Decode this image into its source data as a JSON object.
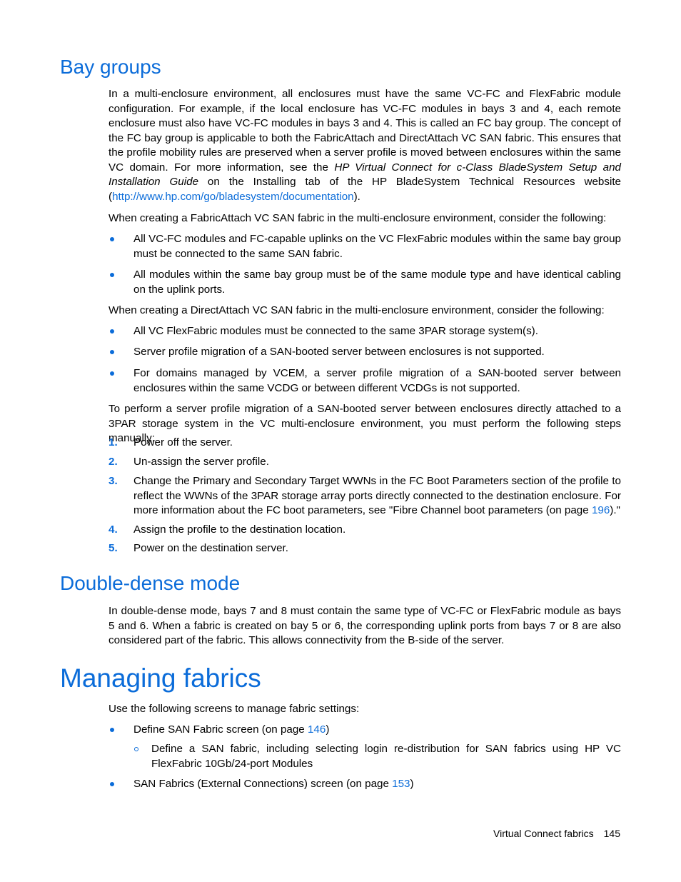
{
  "sections": {
    "bay_groups": {
      "title": "Bay groups",
      "p1_text": "In a multi-enclosure environment, all enclosures must have the same VC-FC and FlexFabric module configuration. For example, if the local enclosure has VC-FC modules in bays 3 and 4, each remote enclosure must also have VC-FC modules in bays 3 and 4. This is called an FC bay group. The concept of the FC bay group is applicable to both the FabricAttach and DirectAttach VC SAN fabric. This ensures that the profile mobility rules are preserved when a server profile is moved between enclosures within the same VC domain. For more information, see the ",
      "p1_italic": "HP Virtual Connect for c-Class BladeSystem Setup and Installation Guide",
      "p1_after_italic": " on the Installing tab of the HP BladeSystem Technical Resources website (",
      "p1_link": "http://www.hp.com/go/bladesystem/documentation",
      "p1_end": ").",
      "p2": "When creating a FabricAttach VC SAN fabric in the multi-enclosure environment, consider the following:",
      "fabricattach_bullets": [
        "All VC-FC modules and FC-capable uplinks on the VC FlexFabric modules within the same bay group must be connected to the same SAN fabric.",
        "All modules within the same bay group must be of the same module type and have identical cabling on the uplink ports."
      ],
      "p3": "When creating a DirectAttach VC SAN fabric in the multi-enclosure environment, consider the following:",
      "directattach_bullets": [
        "All VC FlexFabric modules must be connected to the same 3PAR storage system(s).",
        "Server profile migration of a SAN-booted server between enclosures is not supported.",
        "For domains managed by VCEM, a server profile migration of a SAN-booted server between enclosures within the same VCDG or between different VCDGs is not supported."
      ],
      "p4": "To perform a server profile migration of a SAN-booted server between enclosures directly attached to a 3PAR storage system in the VC multi-enclosure environment, you must perform the following steps manually:",
      "steps": [
        {
          "num": "1.",
          "text": "Power off the server."
        },
        {
          "num": "2.",
          "text": "Un-assign the server profile."
        },
        {
          "num": "3.",
          "text": "Change the Primary and Secondary Target WWNs in the FC Boot Parameters section of the profile to reflect the WWNs of the 3PAR storage array ports directly connected to the destination enclosure. For more information about the FC boot parameters, see \"Fibre Channel boot parameters (on page ",
          "link": "196",
          "end": ").\""
        },
        {
          "num": "4.",
          "text": "Assign the profile to the destination location."
        },
        {
          "num": "5.",
          "text": "Power on the destination server."
        }
      ]
    },
    "double_dense": {
      "title": "Double-dense mode",
      "p1": "In double-dense mode, bays 7 and 8 must contain the same type of VC-FC or FlexFabric module as bays 5 and 6. When a fabric is created on bay 5 or 6, the corresponding uplink ports from bays 7 or 8 are also considered part of the fabric. This allows connectivity from the B-side of the server."
    },
    "managing_fabrics": {
      "title": "Managing fabrics",
      "p1": "Use the following screens to manage fabric settings:",
      "items": [
        {
          "text": "Define SAN Fabric screen (on page ",
          "link": "146",
          "end": ")",
          "sub": "Define a SAN fabric, including selecting login re-distribution for SAN fabrics using HP VC FlexFabric 10Gb/24-port Modules"
        },
        {
          "text": "SAN Fabrics (External Connections) screen (on page ",
          "link": "153",
          "end": ")"
        }
      ]
    }
  },
  "footer": {
    "section": "Virtual Connect fabrics",
    "page": "145"
  },
  "colors": {
    "heading": "#0b6cd9",
    "link": "#0b6cd9"
  }
}
